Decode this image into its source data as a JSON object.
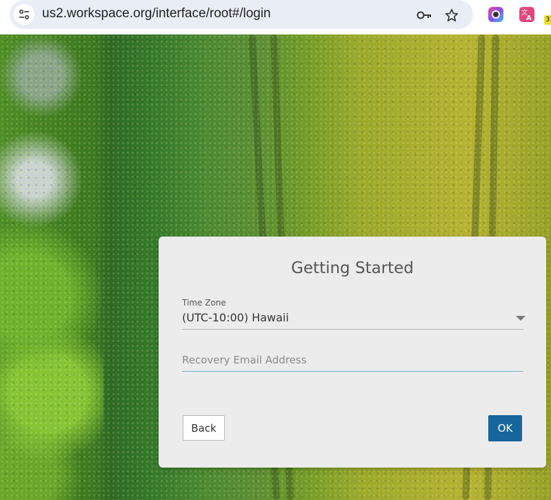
{
  "browser": {
    "url": "us2.workspace.org/interface/root#/login",
    "icons": [
      "site-info-icon",
      "key-icon",
      "star-icon",
      "camera-extension-icon",
      "translate-extension-icon"
    ],
    "extension_badge": "3"
  },
  "dialog": {
    "title": "Getting Started",
    "timezone_label": "Time Zone",
    "timezone_value": "(UTC-10:00) Hawaii",
    "email_placeholder": "Recovery Email Address",
    "email_value": "",
    "back_label": "Back",
    "ok_label": "OK"
  },
  "colors": {
    "ok_button": "#16659c",
    "dialog_bg": "#ececec",
    "email_underline": "#7fb0c4"
  }
}
